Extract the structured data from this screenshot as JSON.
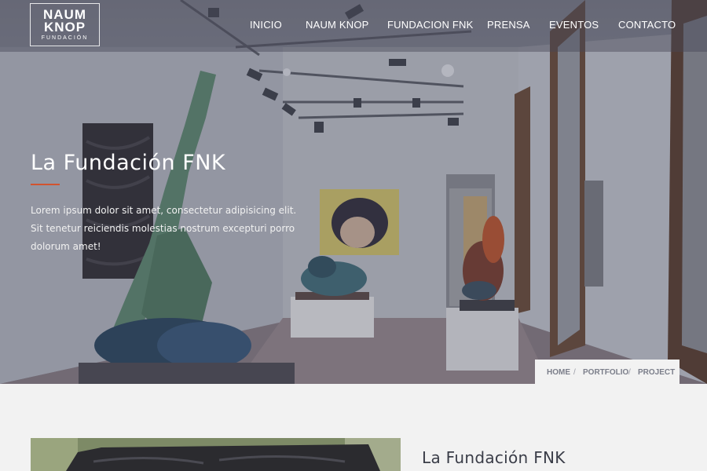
{
  "logo": {
    "line1": "NAUM",
    "line2": "KNOP",
    "line3": "FUNDACIÓN"
  },
  "nav": {
    "items": [
      {
        "label": "INICIO"
      },
      {
        "label": "NAUM KNOP"
      },
      {
        "label": "FUNDACION FNK"
      },
      {
        "label": "PRENSA"
      },
      {
        "label": "EVENTOS"
      },
      {
        "label": "CONTACTO"
      }
    ]
  },
  "hero": {
    "title": "La Fundación FNK",
    "text_lines": [
      "Lorem ipsum dolor sit amet, consectetur adipisicing elit.",
      "Sit tenetur reiciendis molestias nostrum excepturi porro",
      "dolorum amet!"
    ]
  },
  "breadcrumb": {
    "items": [
      "HOME",
      "PORTFOLIO",
      "PROJECT"
    ],
    "separator": "/"
  },
  "section": {
    "title": "La Fundación FNK"
  },
  "colors": {
    "accent": "#d2532f",
    "nav_text": "#ffffff",
    "breadcrumb_text": "#7b7e8a",
    "section_title": "#3a3d48",
    "page_background": "#f2f2f2"
  }
}
